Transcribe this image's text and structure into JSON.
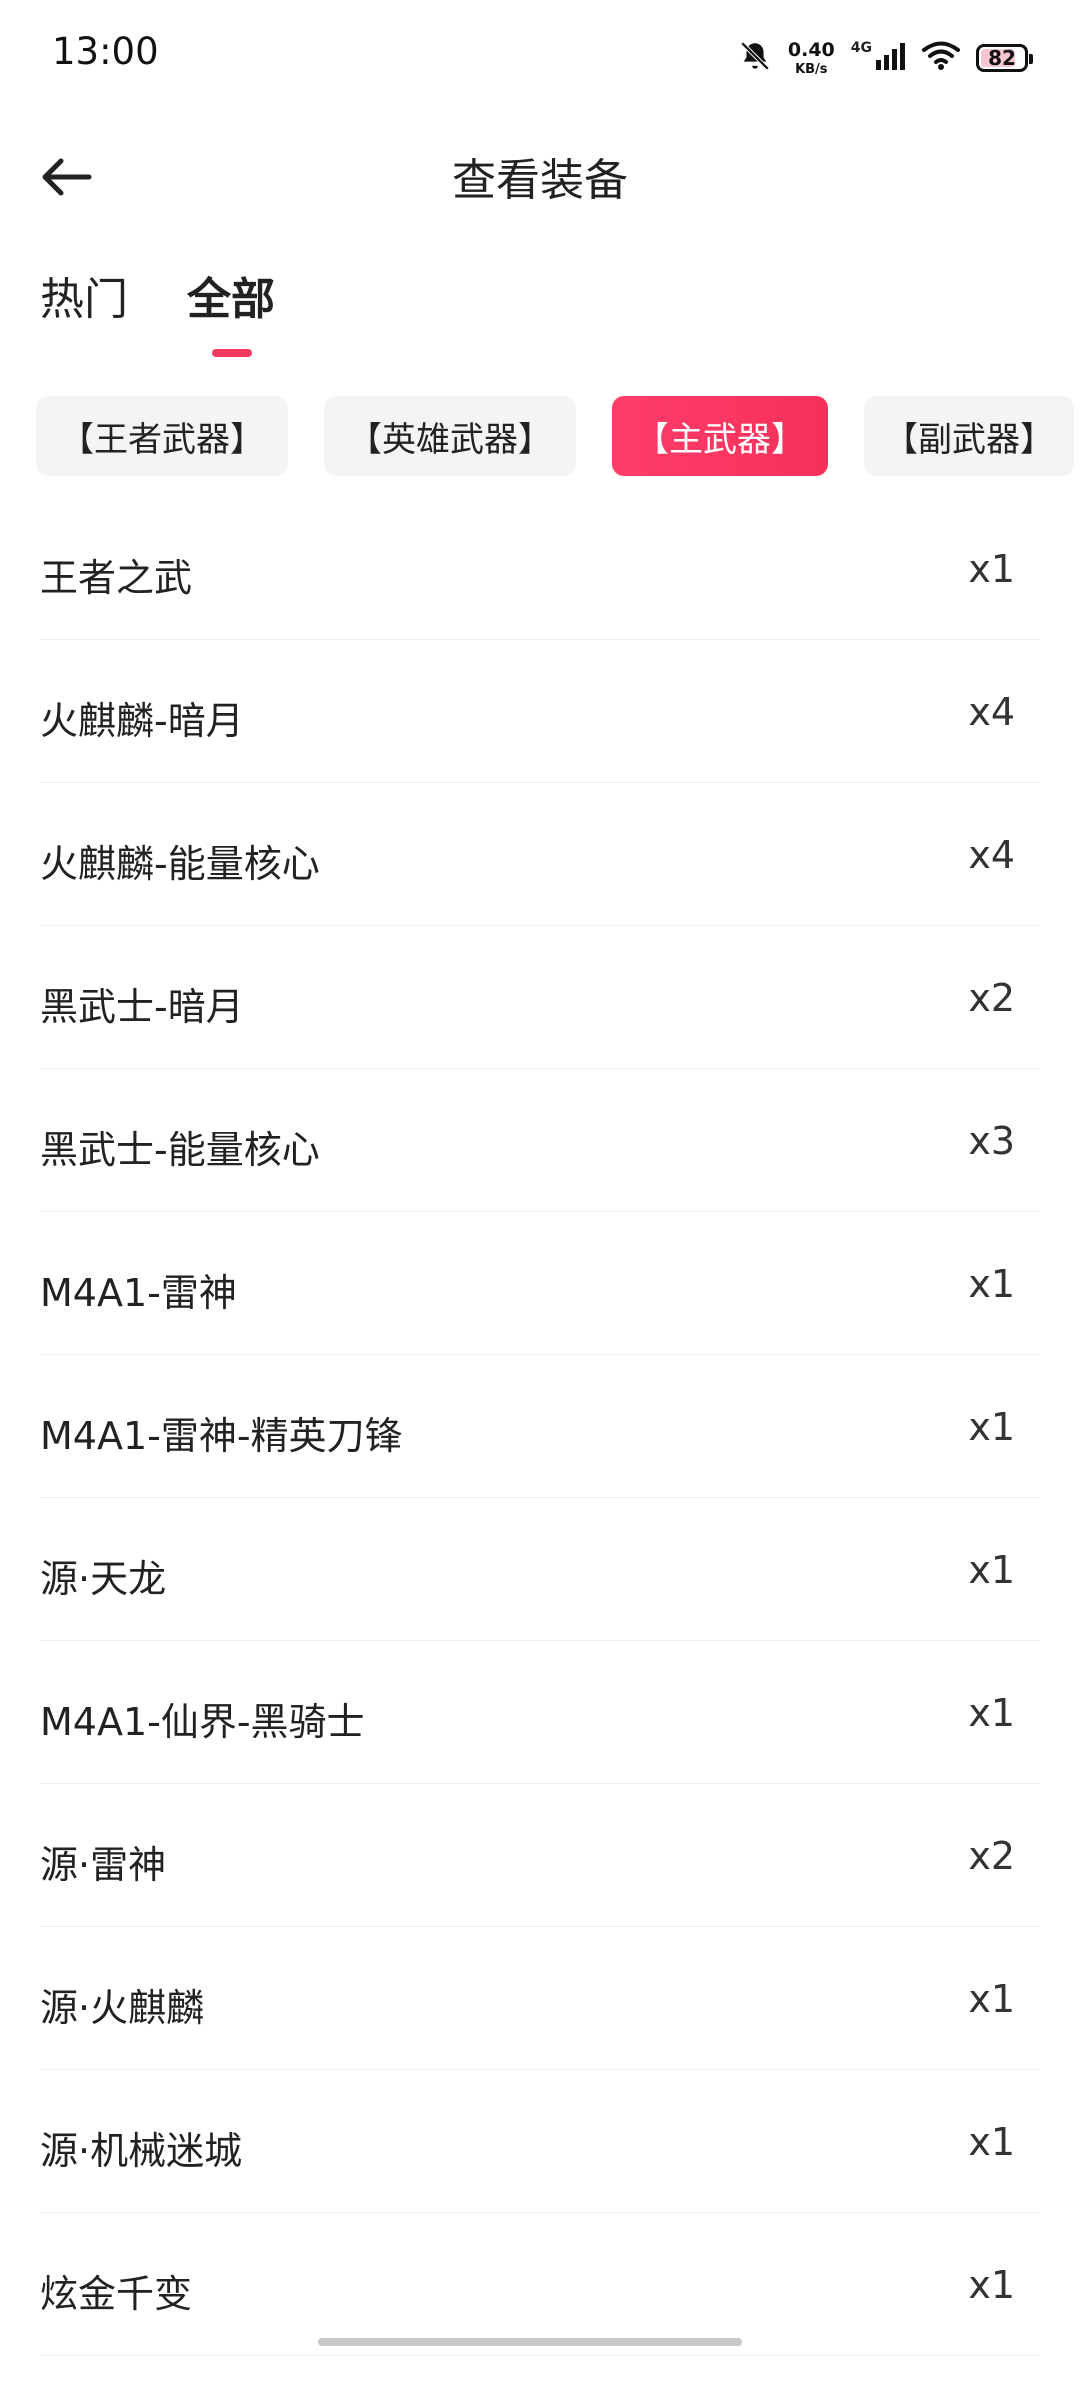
{
  "status_bar": {
    "time": "13:00",
    "net_speed_value": "0.40",
    "net_speed_unit": "KB/s",
    "network": "4G",
    "battery": "82",
    "battery_level": 0.82
  },
  "header": {
    "title": "查看装备"
  },
  "tabs": [
    {
      "label": "热门"
    },
    {
      "label": "全部"
    }
  ],
  "categories": [
    {
      "label": "【王者武器】",
      "active": false
    },
    {
      "label": "【英雄武器】",
      "active": false
    },
    {
      "label": "【主武器】",
      "active": true
    },
    {
      "label": "【副武器】",
      "active": false
    }
  ],
  "items": [
    {
      "name": "王者之武",
      "count": "x1"
    },
    {
      "name": "火麒麟-暗月",
      "count": "x4"
    },
    {
      "name": "火麒麟-能量核心",
      "count": "x4"
    },
    {
      "name": "黑武士-暗月",
      "count": "x2"
    },
    {
      "name": "黑武士-能量核心",
      "count": "x3"
    },
    {
      "name": "M4A1-雷神",
      "count": "x1"
    },
    {
      "name": "M4A1-雷神-精英刀锋",
      "count": "x1"
    },
    {
      "name": "源·天龙",
      "count": "x1"
    },
    {
      "name": "M4A1-仙界-黑骑士",
      "count": "x1"
    },
    {
      "name": "源·雷神",
      "count": "x2"
    },
    {
      "name": "源·火麒麟",
      "count": "x1"
    },
    {
      "name": "源·机械迷城",
      "count": "x1"
    },
    {
      "name": "炫金千变",
      "count": "x1"
    }
  ],
  "colors": {
    "accent": "#f3395d",
    "chip_bg": "#f2f4f6"
  }
}
